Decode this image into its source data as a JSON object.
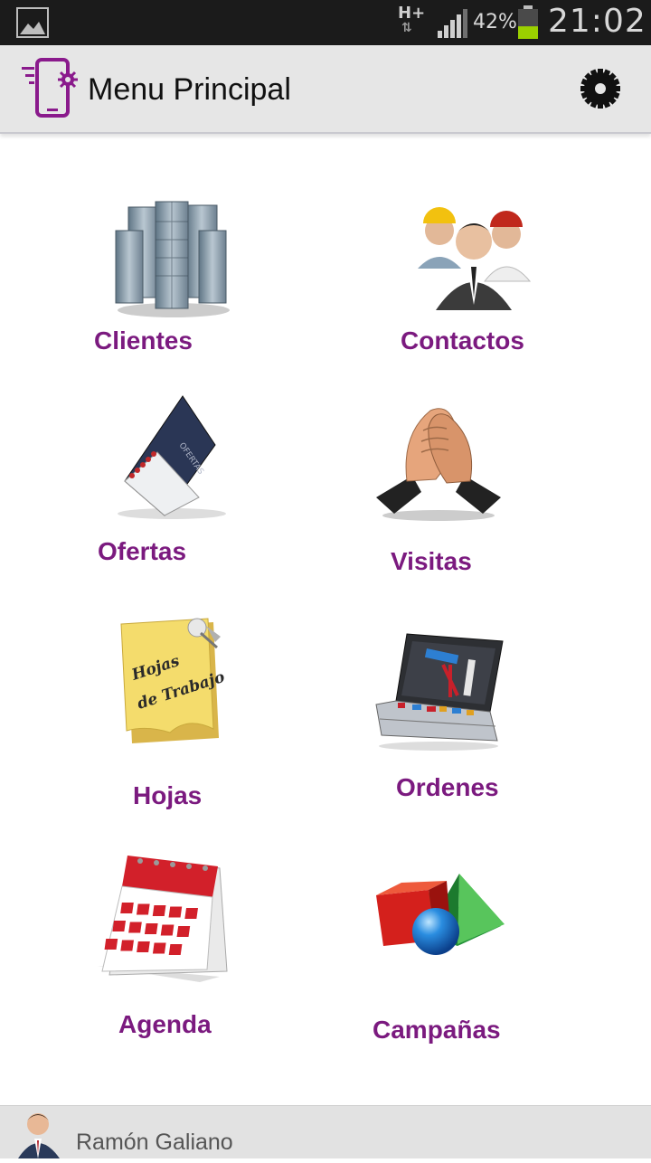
{
  "status_bar": {
    "network": "H+",
    "battery_percent": "42%",
    "battery_level": 0.42,
    "time": "21:02",
    "icons": [
      "gallery-icon",
      "signal-icon",
      "battery-icon"
    ]
  },
  "app_bar": {
    "title": "Menu Principal",
    "app_icon": "phone-settings-icon",
    "settings_icon": "gear-icon"
  },
  "menu": {
    "items": [
      {
        "label": "Clientes",
        "icon": "buildings-icon"
      },
      {
        "label": "Contactos",
        "icon": "people-icon"
      },
      {
        "label": "Ofertas",
        "icon": "notebook-icon"
      },
      {
        "label": "Visitas",
        "icon": "handshake-icon"
      },
      {
        "label": "Hojas",
        "icon": "sticky-note-icon",
        "icon_text": "Hojas de Trabajo"
      },
      {
        "label": "Ordenes",
        "icon": "toolbox-icon"
      },
      {
        "label": "Agenda",
        "icon": "calendar-icon"
      },
      {
        "label": "Campañas",
        "icon": "shapes-icon"
      }
    ]
  },
  "footer": {
    "user_name": "Ramón Galiano",
    "avatar_icon": "user-avatar-icon"
  },
  "colors": {
    "accent": "#7b1a7f",
    "status_bar_bg": "#1b1b1b",
    "app_bar_bg": "#e6e6e6",
    "battery_fill": "#9bd000"
  }
}
